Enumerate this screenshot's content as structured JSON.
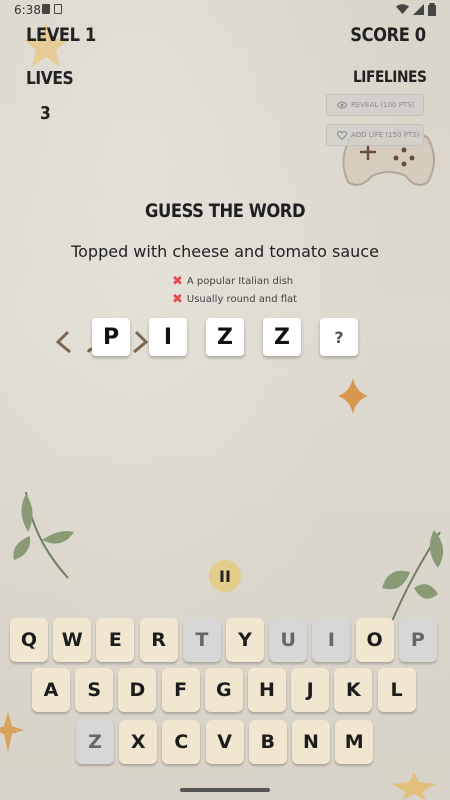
{
  "status_bar": {
    "time": "6:38"
  },
  "hud": {
    "level": "LEVEL 1",
    "score": "SCORE 0",
    "lives_label": "LIVES",
    "lives_value": "3",
    "lifelines_label": "LIFELINES",
    "lifelines": [
      {
        "label": "REVEAL (100 PTS)",
        "icon": "eye-icon"
      },
      {
        "label": "ADD LIFE (150 PTS)",
        "icon": "heart-icon"
      }
    ]
  },
  "puzzle": {
    "title": "GUESS THE WORD",
    "clue": "Topped with cheese and tomato sauce",
    "hints": [
      "A popular Italian dish",
      "Usually round and flat"
    ],
    "tiles": [
      "P",
      "I",
      "Z",
      "Z",
      "?"
    ]
  },
  "pause_label": "II",
  "keyboard": {
    "row1": [
      "Q",
      "W",
      "E",
      "R",
      "T",
      "Y",
      "U",
      "I",
      "O",
      "P"
    ],
    "row2": [
      "A",
      "S",
      "D",
      "F",
      "G",
      "H",
      "J",
      "K",
      "L"
    ],
    "row3": [
      "Z",
      "X",
      "C",
      "V",
      "B",
      "N",
      "M"
    ],
    "used_letters": [
      "T",
      "U",
      "I",
      "P",
      "Z"
    ]
  },
  "colors": {
    "background": "#dcd7cc",
    "key": "#f1e6d0",
    "key_used": "#d7d7d7",
    "pause": "#e2cd8b",
    "hint_x": "#e84d4d"
  }
}
